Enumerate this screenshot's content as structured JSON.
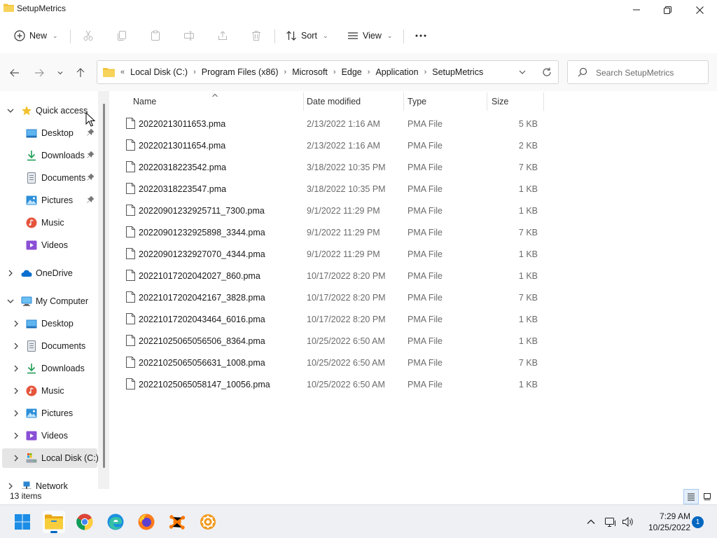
{
  "window": {
    "title": "SetupMetrics"
  },
  "toolbar": {
    "new_label": "New",
    "sort_label": "Sort",
    "view_label": "View",
    "more_label": "···"
  },
  "address": {
    "overflow": "«",
    "crumbs": [
      "Local Disk (C:)",
      "Program Files (x86)",
      "Microsoft",
      "Edge",
      "Application",
      "SetupMetrics"
    ]
  },
  "search": {
    "placeholder": "Search SetupMetrics"
  },
  "sidebar": {
    "quick_access": "Quick access",
    "qa_items": [
      "Desktop",
      "Downloads",
      "Documents",
      "Pictures",
      "Music",
      "Videos"
    ],
    "onedrive": "OneDrive",
    "my_computer": "My Computer",
    "mc_items": [
      "Desktop",
      "Documents",
      "Downloads",
      "Music",
      "Pictures",
      "Videos",
      "Local Disk (C:)"
    ],
    "network": "Network"
  },
  "columns": {
    "name": "Name",
    "date": "Date modified",
    "type": "Type",
    "size": "Size"
  },
  "files": [
    {
      "name": "20220213011653.pma",
      "date": "2/13/2022 1:16 AM",
      "type": "PMA File",
      "size": "5 KB"
    },
    {
      "name": "20220213011654.pma",
      "date": "2/13/2022 1:16 AM",
      "type": "PMA File",
      "size": "2 KB"
    },
    {
      "name": "20220318223542.pma",
      "date": "3/18/2022 10:35 PM",
      "type": "PMA File",
      "size": "7 KB"
    },
    {
      "name": "20220318223547.pma",
      "date": "3/18/2022 10:35 PM",
      "type": "PMA File",
      "size": "1 KB"
    },
    {
      "name": "20220901232925711_7300.pma",
      "date": "9/1/2022 11:29 PM",
      "type": "PMA File",
      "size": "1 KB"
    },
    {
      "name": "20220901232925898_3344.pma",
      "date": "9/1/2022 11:29 PM",
      "type": "PMA File",
      "size": "7 KB"
    },
    {
      "name": "20220901232927070_4344.pma",
      "date": "9/1/2022 11:29 PM",
      "type": "PMA File",
      "size": "1 KB"
    },
    {
      "name": "20221017202042027_860.pma",
      "date": "10/17/2022 8:20 PM",
      "type": "PMA File",
      "size": "1 KB"
    },
    {
      "name": "20221017202042167_3828.pma",
      "date": "10/17/2022 8:20 PM",
      "type": "PMA File",
      "size": "7 KB"
    },
    {
      "name": "20221017202043464_6016.pma",
      "date": "10/17/2022 8:20 PM",
      "type": "PMA File",
      "size": "1 KB"
    },
    {
      "name": "20221025065056506_8364.pma",
      "date": "10/25/2022 6:50 AM",
      "type": "PMA File",
      "size": "1 KB"
    },
    {
      "name": "20221025065056631_1008.pma",
      "date": "10/25/2022 6:50 AM",
      "type": "PMA File",
      "size": "7 KB"
    },
    {
      "name": "20221025065058147_10056.pma",
      "date": "10/25/2022 6:50 AM",
      "type": "PMA File",
      "size": "1 KB"
    }
  ],
  "status": {
    "item_count": "13 items"
  },
  "taskbar": {
    "apps": [
      "start-icon",
      "file-explorer-icon",
      "chrome-icon",
      "edge-icon",
      "firefox-icon",
      "avast-icon",
      "settings-app-icon"
    ],
    "time": "7:29 AM",
    "date": "10/25/2022",
    "notification_count": "1"
  },
  "colors": {
    "accent": "#0067c0",
    "folder": "#f3c23c",
    "selected_bg": "#e5e5e5"
  }
}
